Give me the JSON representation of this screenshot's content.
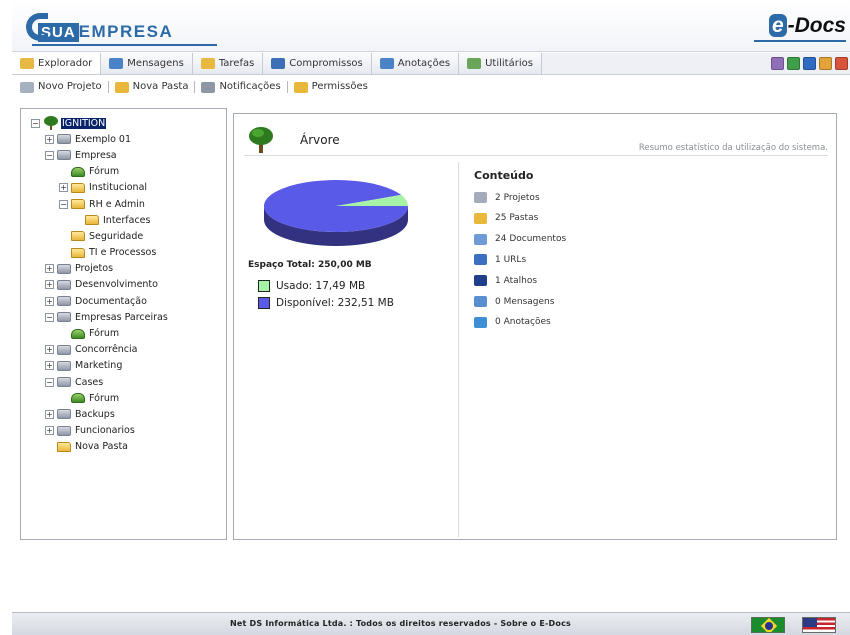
{
  "header": {
    "logo_sua": "SUA",
    "logo_empresa": "EMPRESA",
    "product_e": "e",
    "product_name": "-Docs"
  },
  "tabs": [
    {
      "label": "Explorador",
      "icon": "explorer-icon",
      "color": "#e7b842",
      "active": true
    },
    {
      "label": "Mensagens",
      "icon": "messages-icon",
      "color": "#4a84c6",
      "active": false
    },
    {
      "label": "Tarefas",
      "icon": "tasks-icon",
      "color": "#e7b842",
      "active": false
    },
    {
      "label": "Compromissos",
      "icon": "appointments-icon",
      "color": "#3c6fb5",
      "active": false
    },
    {
      "label": "Anotações",
      "icon": "notes-icon",
      "color": "#4a84c6",
      "active": false
    },
    {
      "label": "Utilitários",
      "icon": "utilities-icon",
      "color": "#6aa65a",
      "active": false
    }
  ],
  "tab_tools": [
    {
      "icon": "window-icon",
      "color": "#8f6fb8"
    },
    {
      "icon": "home-icon",
      "color": "#3f9e4a"
    },
    {
      "icon": "help-icon",
      "color": "#2f6bc2"
    },
    {
      "icon": "edit-icon",
      "color": "#e3a33a"
    },
    {
      "icon": "close-icon",
      "color": "#d9533a"
    }
  ],
  "actions": [
    {
      "label": "Novo Projeto",
      "icon": "new-project-icon",
      "color": "#a7b0bf"
    },
    {
      "label": "Nova Pasta",
      "icon": "new-folder-icon",
      "color": "#e9b73a"
    },
    {
      "label": "Notificações",
      "icon": "notifications-icon",
      "color": "#8e96a6"
    },
    {
      "label": "Permissões",
      "icon": "permissions-icon",
      "color": "#e9b73a"
    }
  ],
  "tree": [
    {
      "label": "IGNITION",
      "level": 0,
      "exp": "-",
      "icon": "root",
      "selected": true
    },
    {
      "label": "Exemplo 01",
      "level": 1,
      "exp": "+",
      "icon": "server"
    },
    {
      "label": "Empresa",
      "level": 1,
      "exp": "-",
      "icon": "server"
    },
    {
      "label": "Fórum",
      "level": 2,
      "exp": "",
      "icon": "forum"
    },
    {
      "label": "Institucional",
      "level": 2,
      "exp": "+",
      "icon": "folder"
    },
    {
      "label": "RH e Admin",
      "level": 2,
      "exp": "-",
      "icon": "folder"
    },
    {
      "label": "Interfaces",
      "level": 3,
      "exp": "",
      "icon": "folder"
    },
    {
      "label": "Seguridade",
      "level": 2,
      "exp": "",
      "icon": "folder"
    },
    {
      "label": "TI e Processos",
      "level": 2,
      "exp": "",
      "icon": "folder"
    },
    {
      "label": "Projetos",
      "level": 1,
      "exp": "+",
      "icon": "server"
    },
    {
      "label": "Desenvolvimento",
      "level": 1,
      "exp": "+",
      "icon": "server"
    },
    {
      "label": "Documentação",
      "level": 1,
      "exp": "+",
      "icon": "server"
    },
    {
      "label": "Empresas Parceiras",
      "level": 1,
      "exp": "-",
      "icon": "server"
    },
    {
      "label": "Fórum",
      "level": 2,
      "exp": "",
      "icon": "forum"
    },
    {
      "label": "Concorrência",
      "level": 1,
      "exp": "+",
      "icon": "server"
    },
    {
      "label": "Marketing",
      "level": 1,
      "exp": "+",
      "icon": "server"
    },
    {
      "label": "Cases",
      "level": 1,
      "exp": "-",
      "icon": "server"
    },
    {
      "label": "Fórum",
      "level": 2,
      "exp": "",
      "icon": "forum"
    },
    {
      "label": "Backups",
      "level": 1,
      "exp": "+",
      "icon": "server"
    },
    {
      "label": "Funcionarios",
      "level": 1,
      "exp": "+",
      "icon": "server"
    },
    {
      "label": "Nova Pasta",
      "level": 1,
      "exp": "",
      "icon": "folder"
    }
  ],
  "panel": {
    "title": "Árvore",
    "subtitle": "Resumo estatístico da utilização do sistema.",
    "espaco_total": "Espaço Total: 250,00 MB",
    "usado_label": "Usado: 17,49 MB",
    "disponivel_label": "Disponível: 232,51 MB",
    "usado_mb": 17.49,
    "disponivel_mb": 232.51,
    "usado_color": "#a6f2a6",
    "disponivel_color": "#5a5ae8"
  },
  "conteudo": {
    "title": "Conteúdo",
    "items": [
      {
        "label": "2 Projetos",
        "icon": "projects-icon",
        "color": "#a4acbb"
      },
      {
        "label": "25 Pastas",
        "icon": "folders-icon",
        "color": "#e9b73a"
      },
      {
        "label": "24 Documentos",
        "icon": "documents-icon",
        "color": "#6e9ad6"
      },
      {
        "label": "1 URLs",
        "icon": "urls-icon",
        "color": "#3b6fc0"
      },
      {
        "label": "1 Atalhos",
        "icon": "shortcuts-icon",
        "color": "#1f3f8a"
      },
      {
        "label": "0 Mensagens",
        "icon": "messages-icon",
        "color": "#5a8ed0"
      },
      {
        "label": "0 Anotações",
        "icon": "notes-icon",
        "color": "#3f8fd6"
      }
    ]
  },
  "footer": {
    "text": "Net DS Informática Ltda. : Todos os direitos reservados - Sobre o E-Docs"
  }
}
